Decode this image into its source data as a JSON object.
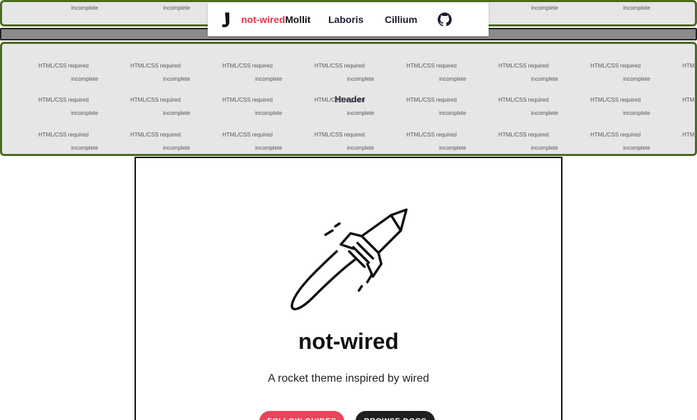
{
  "wireframe": {
    "header_label": "Header",
    "required_text": "HTML/CSS required",
    "incomplete_text": "incomplete",
    "band_color": "#e6e6e6",
    "border_color": "#4b6b1e"
  },
  "nav": {
    "logo_icon": "sock-icon",
    "brand_red": "not-wired",
    "brand_dark": "Mollit",
    "links": [
      "Laboris",
      "Cillium"
    ],
    "github_icon": "github-icon",
    "brand_color": "#e8334a"
  },
  "hero": {
    "illustration": "rocket-icon",
    "title": "not-wired",
    "subtitle": "A rocket theme inspired by wired",
    "buttons": {
      "guides": "FOLLOW GUIDES",
      "docs": "BROWSE DOCS"
    },
    "guides_color": "#e8445a",
    "docs_color": "#1f1f1f"
  }
}
